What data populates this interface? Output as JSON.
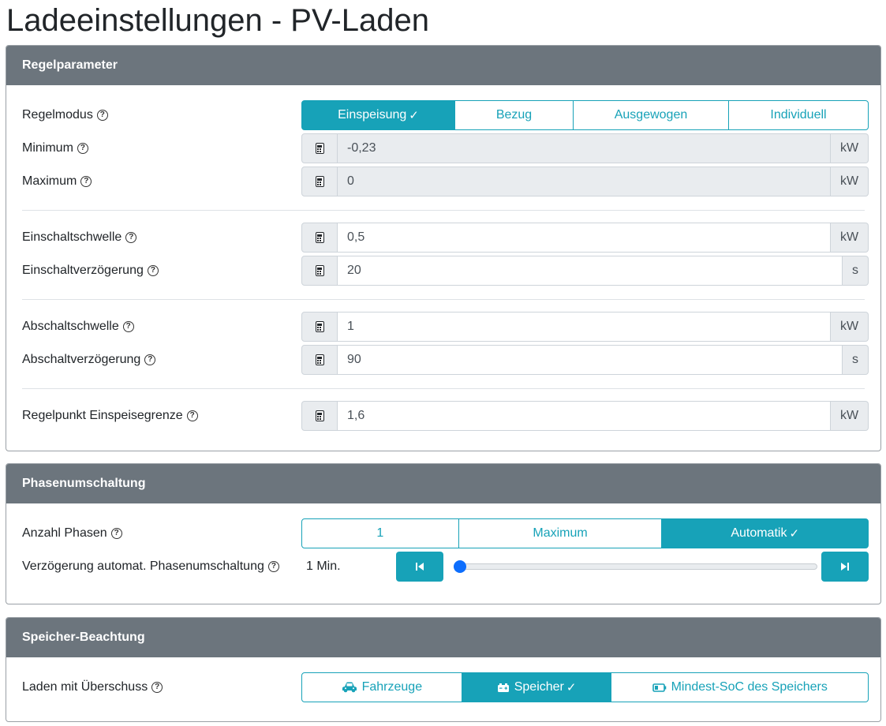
{
  "page": {
    "title": "Ladeeinstellungen - PV-Laden"
  },
  "colors": {
    "accent": "#17a2b8",
    "header_bg": "#6c757d",
    "slider_thumb": "#0d6efd"
  },
  "regelparameter": {
    "header": "Regelparameter",
    "regelmodus": {
      "label": "Regelmodus",
      "options": [
        "Einspeisung",
        "Bezug",
        "Ausgewogen",
        "Individuell"
      ],
      "selected": "Einspeisung",
      "check": "✓"
    },
    "minimum": {
      "label": "Minimum",
      "value": "-0,23",
      "unit": "kW"
    },
    "maximum": {
      "label": "Maximum",
      "value": "0",
      "unit": "kW"
    },
    "einschaltschwelle": {
      "label": "Einschaltschwelle",
      "value": "0,5",
      "unit": "kW"
    },
    "einschaltverzoegerung": {
      "label": "Einschaltverzögerung",
      "value": "20",
      "unit": "s"
    },
    "abschaltschwelle": {
      "label": "Abschaltschwelle",
      "value": "1",
      "unit": "kW"
    },
    "abschaltverzoegerung": {
      "label": "Abschaltverzögerung",
      "value": "90",
      "unit": "s"
    },
    "regelpunkt": {
      "label": "Regelpunkt Einspeisegrenze",
      "value": "1,6",
      "unit": "kW"
    }
  },
  "phasenumschaltung": {
    "header": "Phasenumschaltung",
    "anzahl_phasen": {
      "label": "Anzahl Phasen",
      "options": [
        "1",
        "Maximum",
        "Automatik"
      ],
      "selected": "Automatik",
      "check": "✓"
    },
    "verzoegerung": {
      "label": "Verzögerung automat. Phasenumschaltung",
      "value": "1 Min.",
      "slider_fraction": 0.0
    }
  },
  "speicher": {
    "header": "Speicher-Beachtung",
    "laden_mit_ueberschuss": {
      "label": "Laden mit Überschuss",
      "options": [
        "Fahrzeuge",
        "Speicher",
        "Mindest-SoC des Speichers"
      ],
      "selected": "Speicher",
      "check": "✓"
    }
  }
}
